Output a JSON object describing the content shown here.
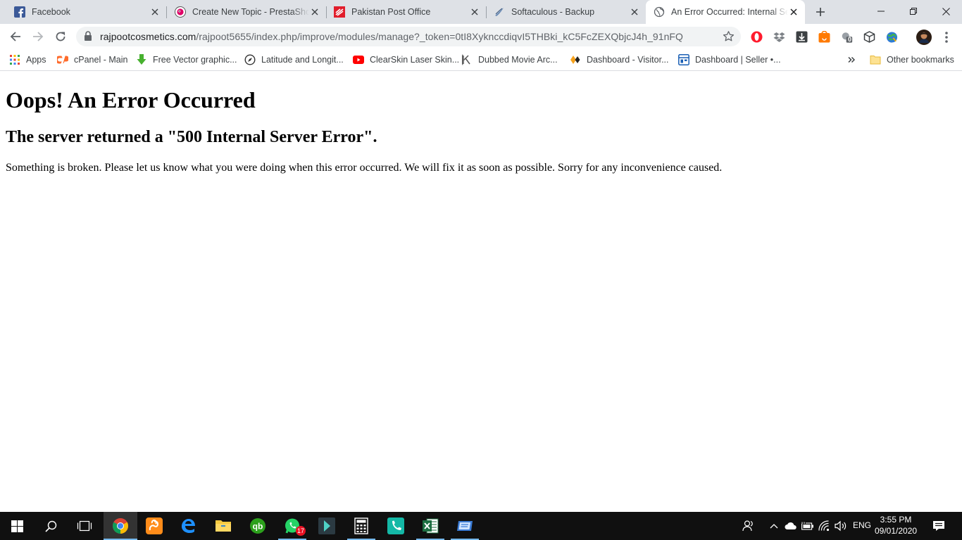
{
  "browser": {
    "tabs": [
      {
        "title": "Facebook",
        "icon": "facebook-icon"
      },
      {
        "title": "Create New Topic - PrestaShop",
        "icon": "prestashop-icon"
      },
      {
        "title": "Pakistan Post Office",
        "icon": "pakistan-post-icon"
      },
      {
        "title": "Softaculous - Backup",
        "icon": "softaculous-icon"
      },
      {
        "title": "An Error Occurred: Internal Server Error",
        "icon": "globe-icon",
        "active": true
      }
    ],
    "url_host": "rajpootcosmetics.com",
    "url_path": "/rajpoot5655/index.php/improve/modules/manage?_token=0tI8XykncсdiqvI5THBki_kC5FcZEXQbjcJ4h_91nFQ",
    "bookmarks": [
      {
        "label": "Apps",
        "icon": "apps-grid-icon"
      },
      {
        "label": "cPanel - Main",
        "icon": "cpanel-icon"
      },
      {
        "label": "Free Vector graphic...",
        "icon": "download-arrow-icon"
      },
      {
        "label": "Latitude and Longit...",
        "icon": "compass-icon"
      },
      {
        "label": "ClearSkin Laser Skin...",
        "icon": "youtube-icon"
      },
      {
        "label": "Dubbed Movie Arc...",
        "icon": "k-icon"
      },
      {
        "label": "Dashboard - Visitor...",
        "icon": "diamond-icon"
      },
      {
        "label": "Dashboard | Seller •...",
        "icon": "seller-icon"
      }
    ],
    "other_bookmarks": "Other bookmarks",
    "ext_badge": "0"
  },
  "page": {
    "heading": "Oops! An Error Occurred",
    "subheading": "The server returned a \"500 Internal Server Error\".",
    "message": "Something is broken. Please let us know what you were doing when this error occurred. We will fix it as soon as possible. Sorry for any inconvenience caused."
  },
  "taskbar": {
    "whatsapp_badge": "17",
    "language": "ENG",
    "time": "3:55 PM",
    "date": "09/01/2020"
  },
  "colors": {
    "tabstrip": "#dee1e6",
    "taskbar": "#101010",
    "accent": "#1a73e8"
  }
}
